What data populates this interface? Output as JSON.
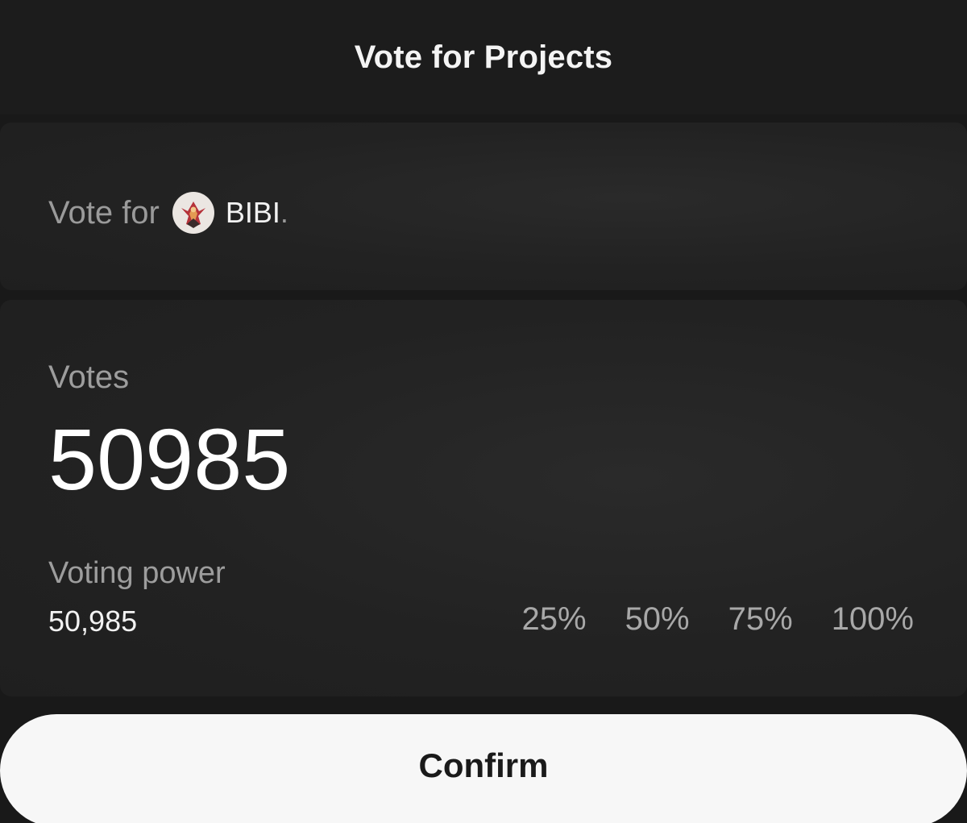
{
  "header": {
    "title": "Vote for Projects"
  },
  "project": {
    "prefix": "Vote for",
    "icon": "bibi-logo-icon",
    "name": "BIBI",
    "suffix": "."
  },
  "votes": {
    "label": "Votes",
    "value": "50985"
  },
  "voting_power": {
    "label": "Voting power",
    "value": "50,985"
  },
  "percent_options": [
    "25%",
    "50%",
    "75%",
    "100%"
  ],
  "confirm": {
    "label": "Confirm"
  },
  "colors": {
    "background": "#191919",
    "card": "#242424",
    "muted_text": "#9d9d9d",
    "primary_text": "#ffffff",
    "button_bg": "#f7f7f7",
    "button_text": "#1a1a1a"
  }
}
